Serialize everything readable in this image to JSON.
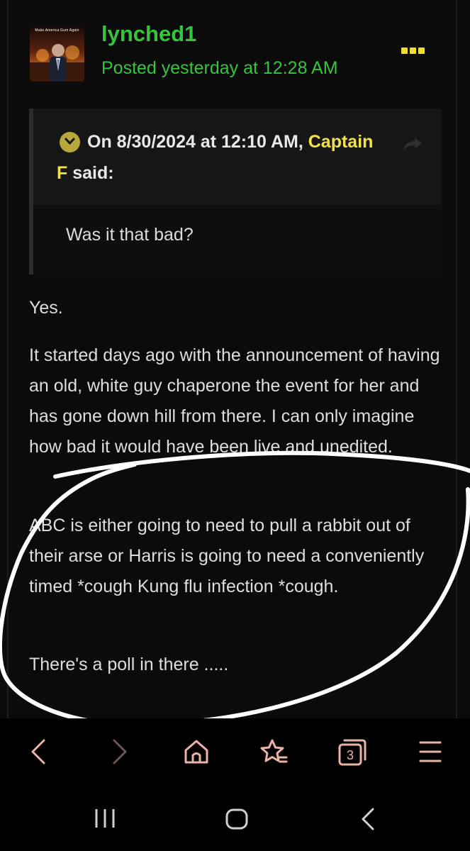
{
  "post": {
    "avatar_caption": "Make America Gum Again",
    "username": "lynched1",
    "posted": "Posted yesterday at 12:28 AM",
    "quote": {
      "line1_prefix": "On 8/30/2024 at 12:10 AM, ",
      "author_part1": "Captain",
      "author_part2": "F",
      "said": " said:",
      "body": "Was it that bad?"
    },
    "paragraphs": [
      "Yes.",
      "It started days ago with the announcement of having an old, white guy chaperone the event for her and has gone down hill from there. I can only imagine how bad it would have been live and unedited.",
      "ABC is either going to need to pull a rabbit out of their arse or Harris is going to need a conveniently timed *cough Kung flu infection *cough.",
      "There's a poll in there ....."
    ]
  },
  "browser_toolbar": {
    "tabs_count": "3",
    "icons": [
      "back-icon",
      "forward-icon",
      "home-icon",
      "bookmark-icon",
      "tabs-icon",
      "menu-icon"
    ],
    "accent_color": "#e9b3a8"
  },
  "system_nav": {
    "icons": [
      "recents-icon",
      "home-icon",
      "back-icon"
    ]
  },
  "colors": {
    "username": "#36c43b",
    "quote_author": "#f3e14a",
    "more_dots": "#f0de38",
    "background": "#0b0b0b"
  }
}
